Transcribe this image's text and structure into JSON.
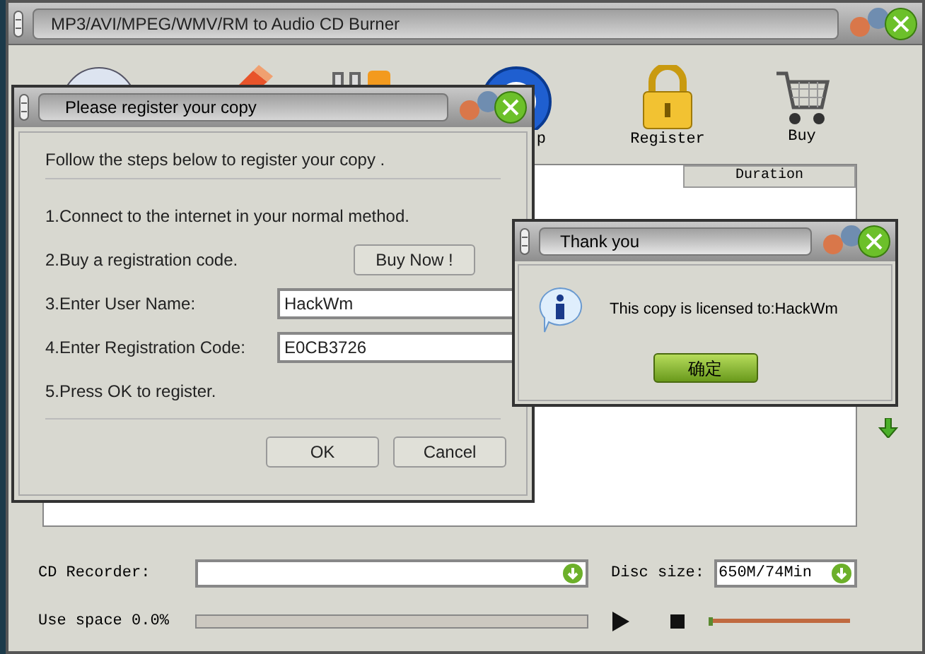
{
  "window": {
    "title": "MP3/AVI/MPEG/WMV/RM to Audio CD Burner"
  },
  "toolbar": [
    {
      "kind": "disc"
    },
    {
      "kind": "pencil"
    },
    {
      "kind": "tools"
    },
    {
      "kind": "help",
      "label": "p"
    },
    {
      "kind": "lock",
      "label": "Register"
    },
    {
      "kind": "cart",
      "label": "Buy"
    }
  ],
  "table": {
    "columns": [
      "Duration"
    ]
  },
  "recorder": {
    "label": "CD Recorder:"
  },
  "disc_size": {
    "label": "Disc size:",
    "value": "650M/74Min"
  },
  "use_space": {
    "label": "Use space 0.0%",
    "level": 0
  },
  "volume": {
    "level": 0
  },
  "register_dialog": {
    "title": "Please register your copy",
    "intro": "Follow the steps below to register your copy .",
    "steps": [
      {
        "kind": "text",
        "label": "1.Connect to the internet in your normal method."
      },
      {
        "kind": "button",
        "label": "2.Buy a registration code.",
        "button": "Buy Now !"
      },
      {
        "kind": "field",
        "label": "3.Enter User Name:",
        "value": "HackWm"
      },
      {
        "kind": "field",
        "label": "4.Enter Registration Code:",
        "value": "E0CB3726"
      },
      {
        "kind": "text",
        "label": "5.Press OK to register."
      }
    ],
    "buttons": [
      "OK",
      "Cancel"
    ]
  },
  "thanks_dialog": {
    "title": "Thank you",
    "message": "This copy is licensed to:HackWm",
    "button": "确定"
  }
}
